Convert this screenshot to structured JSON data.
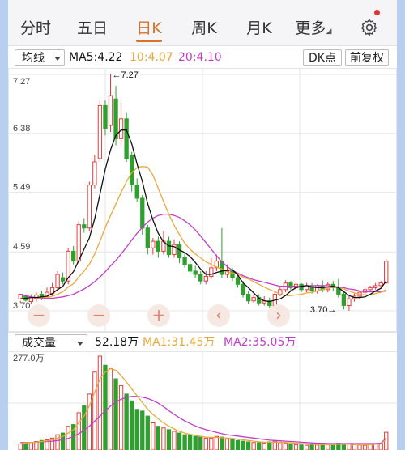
{
  "tabs": [
    {
      "label": "分时",
      "active": false
    },
    {
      "label": "五日",
      "active": false
    },
    {
      "label": "日K",
      "active": true
    },
    {
      "label": "周K",
      "active": false
    },
    {
      "label": "月K",
      "active": false
    },
    {
      "label": "更多",
      "active": false
    }
  ],
  "more_caret": "◢",
  "settings_icon": "gear-icon",
  "indicator": {
    "selector": "均线",
    "ma5": "MA5:4.22",
    "ma10": "10:4.07",
    "ma20": "20:4.10",
    "dk_button": "DK点",
    "adjust_button": "前复权"
  },
  "price_axis": [
    "7.27",
    "6.38",
    "5.49",
    "4.59",
    "3.70"
  ],
  "high_annotation": "←7.27",
  "low_annotation": "3.70→",
  "volume_panel": {
    "selector": "成交量",
    "volume": "52.18万",
    "ma1": "MA1:31.45万",
    "ma2": "MA2:35.05万",
    "axis_top": "277.0万"
  },
  "controls": [
    "−",
    "−",
    "+",
    "‹",
    "›"
  ],
  "colors": {
    "up": "#e23c3c",
    "down": "#2ea02e",
    "ma5": "#111111",
    "ma10": "#e8a93c",
    "ma20": "#c23cc8",
    "active_tab": "#d6722a",
    "grid": "#e6e6e6"
  },
  "chart_data": {
    "type": "candlestick",
    "ylim": [
      3.7,
      7.27
    ],
    "candles": [
      [
        3.88,
        3.95,
        3.85,
        3.82
      ],
      [
        3.92,
        3.86,
        3.95,
        3.84
      ],
      [
        3.84,
        3.9,
        3.95,
        3.8
      ],
      [
        3.88,
        3.94,
        3.98,
        3.84
      ],
      [
        3.95,
        3.9,
        4.0,
        3.86
      ],
      [
        3.92,
        3.98,
        4.05,
        3.88
      ],
      [
        3.96,
        4.05,
        4.12,
        3.92
      ],
      [
        4.05,
        4.25,
        4.3,
        4.0
      ],
      [
        4.2,
        4.15,
        4.28,
        4.1
      ],
      [
        4.15,
        4.6,
        4.65,
        4.1
      ],
      [
        4.6,
        4.45,
        4.68,
        4.4
      ],
      [
        4.45,
        5.0,
        5.05,
        4.42
      ],
      [
        5.0,
        4.95,
        5.1,
        4.88
      ],
      [
        4.95,
        5.6,
        5.65,
        4.9
      ],
      [
        5.6,
        5.95,
        6.05,
        5.55
      ],
      [
        6.0,
        6.8,
        6.9,
        5.95
      ],
      [
        6.8,
        6.45,
        6.88,
        6.35
      ],
      [
        6.5,
        6.95,
        7.27,
        6.4
      ],
      [
        6.9,
        6.3,
        7.1,
        6.2
      ],
      [
        6.3,
        6.6,
        6.85,
        6.2
      ],
      [
        6.6,
        6.0,
        6.7,
        5.95
      ],
      [
        6.05,
        5.6,
        6.1,
        5.5
      ],
      [
        5.6,
        5.4,
        5.7,
        5.35
      ],
      [
        5.4,
        4.95,
        5.45,
        4.85
      ],
      [
        4.95,
        4.65,
        5.0,
        4.55
      ],
      [
        4.65,
        4.75,
        4.8,
        4.55
      ],
      [
        4.75,
        4.6,
        4.82,
        4.5
      ],
      [
        4.6,
        4.75,
        4.9,
        4.55
      ],
      [
        4.75,
        4.55,
        4.82,
        4.5
      ],
      [
        4.55,
        4.7,
        4.78,
        4.5
      ],
      [
        4.7,
        4.5,
        4.75,
        4.42
      ],
      [
        4.5,
        4.4,
        4.58,
        4.35
      ],
      [
        4.4,
        4.3,
        4.45,
        4.25
      ],
      [
        4.3,
        4.25,
        4.38,
        4.2
      ],
      [
        4.25,
        4.15,
        4.3,
        4.1
      ],
      [
        4.15,
        4.22,
        4.3,
        4.1
      ],
      [
        4.22,
        4.35,
        4.5,
        4.18
      ],
      [
        4.35,
        4.45,
        4.55,
        4.3
      ],
      [
        4.45,
        4.25,
        4.95,
        4.2
      ],
      [
        4.25,
        4.3,
        4.4,
        4.2
      ],
      [
        4.3,
        4.2,
        4.35,
        4.15
      ],
      [
        4.2,
        4.1,
        4.25,
        4.05
      ],
      [
        4.1,
        3.95,
        4.15,
        3.9
      ],
      [
        3.95,
        3.85,
        4.0,
        3.8
      ],
      [
        3.85,
        3.9,
        3.95,
        3.82
      ],
      [
        3.9,
        3.82,
        3.95,
        3.78
      ],
      [
        3.82,
        3.85,
        3.92,
        3.78
      ],
      [
        3.85,
        3.78,
        3.9,
        3.74
      ],
      [
        3.78,
        3.95,
        4.0,
        3.76
      ],
      [
        3.95,
        4.02,
        4.08,
        3.92
      ],
      [
        4.02,
        4.12,
        4.16,
        3.98
      ],
      [
        4.12,
        4.05,
        4.15,
        4.0
      ],
      [
        4.05,
        4.1,
        4.14,
        4.0
      ],
      [
        4.1,
        4.02,
        4.12,
        3.98
      ],
      [
        4.02,
        4.08,
        4.12,
        3.98
      ],
      [
        4.08,
        4.0,
        4.12,
        3.96
      ],
      [
        4.0,
        4.08,
        4.1,
        3.96
      ],
      [
        4.08,
        4.02,
        4.16,
        3.98
      ],
      [
        4.02,
        4.1,
        4.14,
        3.98
      ],
      [
        4.1,
        4.05,
        4.15,
        4.0
      ],
      [
        4.05,
        3.95,
        4.18,
        3.9
      ],
      [
        3.95,
        3.78,
        4.0,
        3.72
      ],
      [
        3.78,
        3.88,
        3.92,
        3.7
      ],
      [
        3.88,
        3.92,
        3.96,
        3.84
      ],
      [
        3.92,
        3.98,
        4.0,
        3.88
      ],
      [
        3.98,
        4.02,
        4.05,
        3.94
      ],
      [
        4.02,
        4.05,
        4.08,
        3.98
      ],
      [
        4.05,
        4.08,
        4.12,
        4.02
      ],
      [
        4.08,
        4.12,
        4.15,
        4.05
      ],
      [
        4.12,
        4.45,
        4.48,
        4.1
      ]
    ],
    "ma5": [
      3.88,
      3.89,
      3.9,
      3.9,
      3.91,
      3.92,
      3.96,
      4.02,
      4.07,
      4.2,
      4.29,
      4.46,
      4.63,
      4.8,
      5.09,
      5.46,
      5.84,
      6.13,
      6.35,
      6.43,
      6.43,
      6.22,
      5.92,
      5.65,
      5.32,
      5.07,
      4.87,
      4.74,
      4.68,
      4.67,
      4.62,
      4.58,
      4.52,
      4.43,
      4.33,
      4.25,
      4.25,
      4.28,
      4.3,
      4.31,
      4.32,
      4.24,
      4.12,
      4.05,
      3.97,
      3.89,
      3.85,
      3.84,
      3.86,
      3.88,
      3.93,
      4.0,
      4.05,
      4.07,
      4.08,
      4.06,
      4.05,
      4.05,
      4.06,
      4.07,
      4.05,
      3.99,
      3.93,
      3.9,
      3.9,
      3.91,
      3.95,
      4.0,
      4.04,
      4.15
    ],
    "ma10": [
      3.89,
      3.89,
      3.9,
      3.9,
      3.9,
      3.9,
      3.92,
      3.95,
      3.99,
      4.06,
      4.11,
      4.21,
      4.3,
      4.4,
      4.56,
      4.75,
      4.96,
      5.14,
      5.31,
      5.49,
      5.65,
      5.79,
      5.86,
      5.88,
      5.87,
      5.75,
      5.55,
      5.35,
      5.16,
      4.99,
      4.85,
      4.72,
      4.63,
      4.56,
      4.5,
      4.44,
      4.4,
      4.36,
      4.33,
      4.29,
      4.27,
      4.25,
      4.21,
      4.18,
      4.14,
      4.1,
      4.06,
      4.02,
      3.99,
      3.95,
      3.93,
      3.93,
      3.94,
      3.95,
      3.97,
      3.98,
      4.0,
      4.02,
      4.04,
      4.06,
      4.05,
      4.03,
      4.0,
      3.97,
      3.95,
      3.94,
      3.94,
      3.96,
      3.98,
      4.02
    ],
    "ma20": [
      3.95,
      3.93,
      3.91,
      3.9,
      3.89,
      3.89,
      3.89,
      3.9,
      3.91,
      3.93,
      3.95,
      3.99,
      4.03,
      4.08,
      4.14,
      4.21,
      4.29,
      4.38,
      4.46,
      4.56,
      4.66,
      4.77,
      4.87,
      4.96,
      5.04,
      5.1,
      5.14,
      5.16,
      5.16,
      5.14,
      5.11,
      5.06,
      5.0,
      4.92,
      4.83,
      4.73,
      4.63,
      4.53,
      4.44,
      4.37,
      4.31,
      4.27,
      4.23,
      4.2,
      4.17,
      4.15,
      4.13,
      4.11,
      4.09,
      4.07,
      4.07,
      4.07,
      4.07,
      4.07,
      4.08,
      4.08,
      4.08,
      4.08,
      4.08,
      4.07,
      4.06,
      4.05,
      4.03,
      4.02,
      4.0,
      3.99,
      3.99,
      3.99,
      3.99,
      4.0
    ],
    "volume_ylim": [
      0,
      277.0
    ],
    "volume": [
      18,
      20,
      22,
      25,
      28,
      30,
      35,
      45,
      50,
      70,
      75,
      110,
      130,
      165,
      230,
      277,
      250,
      240,
      210,
      190,
      165,
      145,
      120,
      115,
      100,
      80,
      70,
      65,
      60,
      55,
      50,
      45,
      45,
      40,
      38,
      35,
      35,
      40,
      38,
      32,
      30,
      28,
      26,
      24,
      22,
      22,
      20,
      24,
      26,
      22,
      20,
      18,
      16,
      15,
      14,
      16,
      15,
      14,
      16,
      18,
      20,
      18,
      17,
      16,
      15,
      14,
      16,
      18,
      20,
      52.18
    ],
    "vol_ma1": [
      20,
      21,
      22,
      23,
      25,
      27,
      30,
      35,
      40,
      50,
      60,
      80,
      100,
      130,
      170,
      210,
      230,
      240,
      235,
      220,
      200,
      180,
      160,
      140,
      120,
      105,
      92,
      80,
      70,
      62,
      55,
      50,
      46,
      43,
      40,
      38,
      37,
      37,
      36,
      35,
      34,
      32,
      30,
      28,
      26,
      24,
      23,
      23,
      23,
      23,
      22,
      21,
      20,
      19,
      18,
      17,
      16,
      16,
      16,
      16,
      17,
      17,
      17,
      17,
      16,
      16,
      16,
      17,
      18,
      31.45
    ],
    "vol_ma2": [
      22,
      22,
      22,
      23,
      24,
      25,
      26,
      28,
      30,
      34,
      40,
      48,
      58,
      70,
      85,
      100,
      115,
      130,
      142,
      150,
      155,
      158,
      158,
      156,
      152,
      146,
      138,
      128,
      116,
      105,
      95,
      86,
      78,
      71,
      65,
      60,
      56,
      52,
      48,
      45,
      43,
      41,
      39,
      37,
      35,
      33,
      31,
      29,
      28,
      27,
      26,
      25,
      24,
      23,
      22,
      21,
      20,
      20,
      19,
      19,
      19,
      19,
      19,
      19,
      19,
      19,
      19,
      19,
      20,
      35.05
    ]
  }
}
